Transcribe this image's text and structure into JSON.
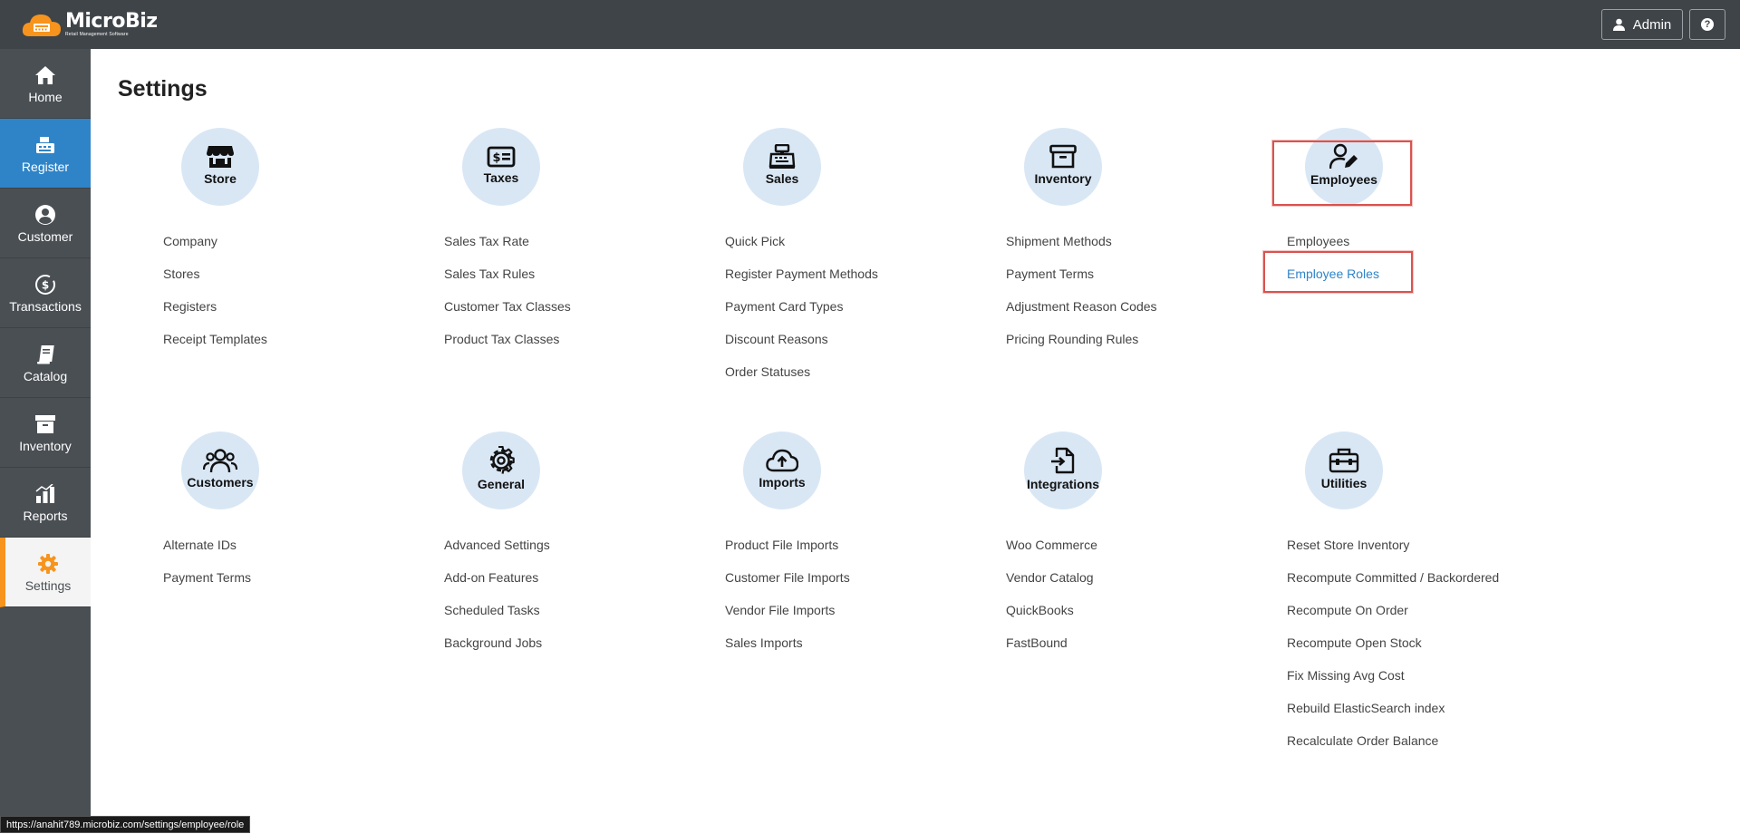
{
  "app": {
    "name": "MicroBiz",
    "tagline": "Retail Management Software"
  },
  "header": {
    "user_label": "Admin",
    "help_label": "?"
  },
  "sidebar": {
    "items": [
      {
        "label": "Home",
        "icon": "home-icon"
      },
      {
        "label": "Register",
        "icon": "register-icon"
      },
      {
        "label": "Customer",
        "icon": "customer-icon"
      },
      {
        "label": "Transactions",
        "icon": "transactions-icon"
      },
      {
        "label": "Catalog",
        "icon": "catalog-icon"
      },
      {
        "label": "Inventory",
        "icon": "inventory-icon"
      },
      {
        "label": "Reports",
        "icon": "reports-icon"
      },
      {
        "label": "Settings",
        "icon": "settings-icon"
      }
    ]
  },
  "page": {
    "title": "Settings"
  },
  "sections": [
    {
      "title": "Store",
      "icon": "store-icon",
      "links": [
        "Company",
        "Stores",
        "Registers",
        "Receipt Templates"
      ]
    },
    {
      "title": "Taxes",
      "icon": "taxes-icon",
      "links": [
        "Sales Tax Rate",
        "Sales Tax Rules",
        "Customer Tax Classes",
        "Product Tax Classes"
      ]
    },
    {
      "title": "Sales",
      "icon": "sales-register-icon",
      "links": [
        "Quick Pick",
        "Register Payment Methods",
        "Payment Card Types",
        "Discount Reasons",
        "Order Statuses"
      ]
    },
    {
      "title": "Inventory",
      "icon": "inventory-box-icon",
      "links": [
        "Shipment Methods",
        "Payment Terms",
        "Adjustment Reason Codes",
        "Pricing Rounding Rules"
      ]
    },
    {
      "title": "Employees",
      "icon": "employee-edit-icon",
      "links": [
        "Employees",
        "Employee Roles"
      ]
    },
    {
      "title": "Customers",
      "icon": "customers-group-icon",
      "links": [
        "Alternate IDs",
        "Payment Terms"
      ]
    },
    {
      "title": "General",
      "icon": "gear-icon",
      "links": [
        "Advanced Settings",
        "Add-on Features",
        "Scheduled Tasks",
        "Background Jobs"
      ]
    },
    {
      "title": "Imports",
      "icon": "cloud-upload-icon",
      "links": [
        "Product File Imports",
        "Customer File Imports",
        "Vendor File Imports",
        "Sales Imports"
      ]
    },
    {
      "title": "Integrations",
      "icon": "file-import-icon",
      "links": [
        "Woo Commerce",
        "Vendor Catalog",
        "QuickBooks",
        "FastBound"
      ]
    },
    {
      "title": "Utilities",
      "icon": "toolbox-icon",
      "links": [
        "Reset Store Inventory",
        "Recompute Committed / Backordered",
        "Recompute On Order",
        "Recompute Open Stock",
        "Fix Missing Avg Cost",
        "Rebuild ElasticSearch index",
        "Recalculate Order Balance"
      ]
    }
  ],
  "status_bar": {
    "url": "https://anahit789.microbiz.com/settings/employee/role"
  },
  "colors": {
    "topbar": "#3f4449",
    "sidebar": "#4a4f54",
    "active_nav": "#2f84c8",
    "settings_accent": "#f7941d",
    "circle_bg": "#d9e7f5",
    "highlight_link": "#2f84c8",
    "annotation_box": "#d9534f"
  }
}
